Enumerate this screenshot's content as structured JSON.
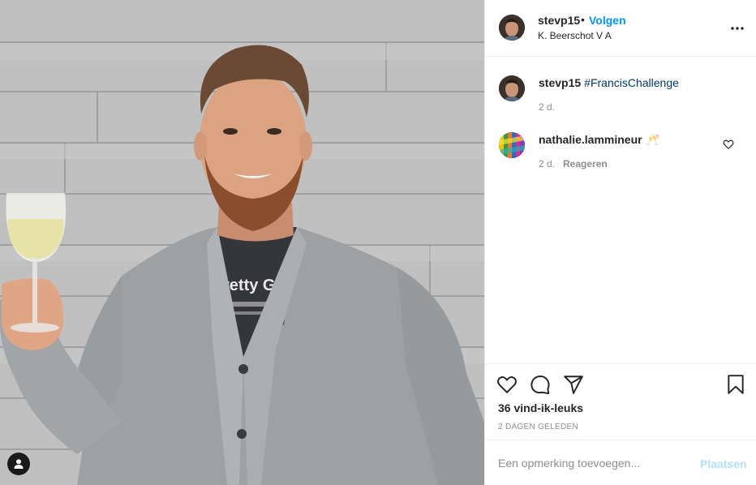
{
  "post": {
    "author": "stevp15",
    "follow_label": "Volgen",
    "separator": "•",
    "location": "K. Beerschot V A",
    "more_icon": "more-horizontal-icon"
  },
  "photo": {
    "shirt_text": "retty Gr",
    "user_tag_icon": "user-tag-icon"
  },
  "comments": [
    {
      "user": "stevp15",
      "text": "#FrancisChallenge",
      "time": "2 d."
    },
    {
      "user": "nathalie.lammineur",
      "text": "🥂",
      "time": "2 d.",
      "reply_label": "Reageren",
      "like_icon": "heart-outline-icon"
    }
  ],
  "actions": {
    "like_icon": "heart-outline-icon",
    "comment_icon": "comment-bubble-icon",
    "share_icon": "paper-plane-icon",
    "save_icon": "bookmark-icon",
    "likes_text": "36 vind-ik-leuks",
    "date_text": "2 DAGEN GELEDEN"
  },
  "add_comment": {
    "placeholder": "Een opmerking toevoegen...",
    "post_label": "Plaatsen"
  },
  "colors": {
    "link_blue": "#0095f6",
    "hashtag_blue": "#00376b",
    "muted_gray": "#8e8e8e",
    "post_disabled": "#b2dffc"
  }
}
